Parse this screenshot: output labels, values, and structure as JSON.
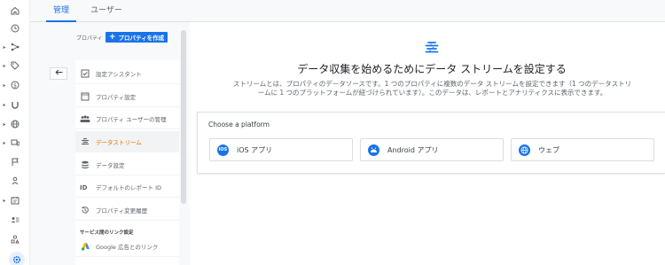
{
  "tabs": [
    {
      "label": "管理"
    },
    {
      "label": "ユーザー"
    }
  ],
  "property": {
    "label": "プロパティ",
    "create_button": "プロパティを作成"
  },
  "nav": {
    "items": [
      {
        "label": "設定アシスタント",
        "icon": "checkbox-icon"
      },
      {
        "label": "プロパティ設定",
        "icon": "square-icon"
      },
      {
        "label": "プロパティ ユーザーの管理",
        "icon": "people-icon"
      },
      {
        "label": "データストリーム",
        "icon": "stream-icon"
      },
      {
        "label": "データ設定",
        "icon": "database-icon"
      },
      {
        "label": "デフォルトのレポート ID",
        "icon": "id-icon"
      },
      {
        "label": "プロパティ変更履歴",
        "icon": "history-icon"
      }
    ],
    "section_title": "サービス間のリンク設定",
    "link_items": [
      {
        "label": "Google 広告とのリンク",
        "icon": "google-ads-icon"
      }
    ]
  },
  "main": {
    "headline": "データ収集を始めるためにデータ ストリームを設定する",
    "description_line1": "ストリームとは、プロパティのデータソースです。1 つのプロパティに複数のデータ ストリームを設定できます（1 つのデータストリ",
    "description_line2": "ームに 1 つのプラットフォームが紐づけられています）。このデータは、レポートとアナリティクスに表示できます。",
    "platform_title": "Choose a platform",
    "platforms": [
      {
        "label": "iOS アプリ",
        "icon_text": "iOS"
      },
      {
        "label": "Android アプリ",
        "icon_text": "A"
      },
      {
        "label": "ウェブ",
        "icon_text": "W"
      }
    ]
  },
  "colors": {
    "accent": "#1a73e8",
    "active_nav": "#e37400"
  }
}
